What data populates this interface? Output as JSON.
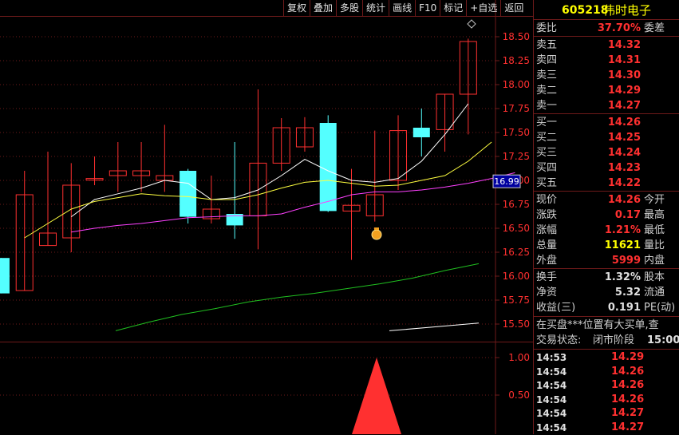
{
  "toolbar": {
    "buttons": [
      "复权",
      "叠加",
      "多股",
      "统计",
      "画线",
      "F10",
      "标记",
      "+自选",
      "返回"
    ]
  },
  "stock": {
    "code": "605218",
    "name": "伟时电子"
  },
  "quote": {
    "ratio_label": "委比",
    "ratio_value": "37.70%",
    "ratio_suffix": "委差",
    "sells": [
      {
        "label": "卖五",
        "price": "14.32"
      },
      {
        "label": "卖四",
        "price": "14.31"
      },
      {
        "label": "卖三",
        "price": "14.30"
      },
      {
        "label": "卖二",
        "price": "14.29"
      },
      {
        "label": "卖一",
        "price": "14.27"
      }
    ],
    "buys": [
      {
        "label": "买一",
        "price": "14.26"
      },
      {
        "label": "买二",
        "price": "14.25"
      },
      {
        "label": "买三",
        "price": "14.24"
      },
      {
        "label": "买四",
        "price": "14.23"
      },
      {
        "label": "买五",
        "price": "14.22"
      }
    ],
    "stats": [
      {
        "label": "现价",
        "value": "14.26",
        "suffix": "今开",
        "color": "red"
      },
      {
        "label": "涨跌",
        "value": "0.17",
        "suffix": "最高",
        "color": "red"
      },
      {
        "label": "涨幅",
        "value": "1.21%",
        "suffix": "最低",
        "color": "red"
      },
      {
        "label": "总量",
        "value": "11621",
        "suffix": "量比",
        "color": "yel"
      },
      {
        "label": "外盘",
        "value": "5999",
        "suffix": "内盘",
        "color": "red"
      }
    ],
    "stats2": [
      {
        "label": "换手",
        "value": "1.32%",
        "suffix": "股本",
        "color": "wht"
      },
      {
        "label": "净资",
        "value": "5.32",
        "suffix": "流通",
        "color": "wht"
      },
      {
        "label": "收益(三)",
        "value": "0.191",
        "suffix": "PE(动)",
        "color": "wht"
      }
    ],
    "message": "在买盘***位置有大买单,查",
    "status_label": "交易状态:",
    "status_value": "闭市阶段",
    "status_time": "15:00:"
  },
  "ticks": [
    {
      "time": "14:53",
      "price": "14.29"
    },
    {
      "time": "14:54",
      "price": "14.26"
    },
    {
      "time": "14:54",
      "price": "14.26"
    },
    {
      "time": "14:54",
      "price": "14.26"
    },
    {
      "time": "14:54",
      "price": "14.27"
    },
    {
      "time": "14:54",
      "price": "14.27"
    }
  ],
  "price_marker": "16.99",
  "colors": {
    "up": "#ff3030",
    "down": "#54ffff",
    "ma_white": "#ffffff",
    "ma_yellow": "#ffff40",
    "ma_magenta": "#ff40ff",
    "ma_green": "#20c020",
    "grid": "#6e1a1a"
  },
  "icons": {
    "toggle": "diamond-icon",
    "event": "money-bag-icon"
  },
  "chart_data": [
    {
      "type": "candlestick",
      "title": "",
      "ylim": [
        15.3,
        18.7
      ],
      "yticks": [
        "18.50",
        "18.25",
        "18.00",
        "17.75",
        "17.50",
        "17.25",
        "17.00",
        "16.75",
        "16.50",
        "16.25",
        "16.00",
        "15.75",
        "15.50"
      ],
      "grid": true,
      "candles": [
        {
          "o": 16.19,
          "h": 16.19,
          "l": 15.82,
          "c": 15.82
        },
        {
          "o": 15.85,
          "h": 17.1,
          "l": 15.85,
          "c": 16.85
        },
        {
          "o": 16.32,
          "h": 17.3,
          "l": 16.32,
          "c": 16.45
        },
        {
          "o": 16.4,
          "h": 17.18,
          "l": 16.25,
          "c": 16.95
        },
        {
          "o": 17.02,
          "h": 17.25,
          "l": 16.95,
          "c": 17.02
        },
        {
          "o": 17.05,
          "h": 17.4,
          "l": 16.88,
          "c": 17.1
        },
        {
          "o": 17.05,
          "h": 17.4,
          "l": 16.88,
          "c": 17.1
        },
        {
          "o": 17.0,
          "h": 17.58,
          "l": 16.88,
          "c": 17.05
        },
        {
          "o": 17.1,
          "h": 17.12,
          "l": 16.55,
          "c": 16.62
        },
        {
          "o": 16.6,
          "h": 17.05,
          "l": 16.55,
          "c": 16.7
        },
        {
          "o": 16.65,
          "h": 17.4,
          "l": 16.39,
          "c": 16.53
        },
        {
          "o": 16.63,
          "h": 17.95,
          "l": 16.28,
          "c": 17.18
        },
        {
          "o": 17.18,
          "h": 17.65,
          "l": 17.1,
          "c": 17.55
        },
        {
          "o": 17.35,
          "h": 17.66,
          "l": 17.3,
          "c": 17.55
        },
        {
          "o": 17.6,
          "h": 17.68,
          "l": 16.67,
          "c": 16.68
        },
        {
          "o": 16.68,
          "h": 17.12,
          "l": 16.17,
          "c": 16.74
        },
        {
          "o": 16.63,
          "h": 17.52,
          "l": 16.57,
          "c": 16.85
        },
        {
          "o": 17.0,
          "h": 17.68,
          "l": 16.9,
          "c": 17.52
        },
        {
          "o": 17.55,
          "h": 17.75,
          "l": 17.25,
          "c": 17.45
        },
        {
          "o": 17.53,
          "h": 17.9,
          "l": 17.3,
          "c": 17.9
        },
        {
          "o": 17.9,
          "h": 18.48,
          "l": 17.48,
          "c": 18.45
        }
      ],
      "series": [
        {
          "values": [
            null,
            null,
            null,
            null,
            16.62,
            16.8,
            16.86,
            16.92,
            17.0,
            16.97,
            16.8,
            16.82,
            16.9,
            17.05,
            17.22,
            17.1,
            17.0,
            16.98,
            17.02,
            17.2,
            17.48,
            17.8
          ]
        },
        {
          "values": [
            16.4,
            16.55,
            16.7,
            16.78,
            16.82,
            16.86,
            16.84,
            16.83,
            16.8,
            16.8,
            16.85,
            16.92,
            16.98,
            17.0,
            16.97,
            16.94,
            16.95,
            17.0,
            17.05,
            17.2,
            17.4
          ]
        },
        {
          "values": [
            16.46,
            16.5,
            16.53,
            16.55,
            16.58,
            16.61,
            16.62,
            16.63,
            16.63,
            16.65,
            16.72,
            16.78,
            16.85,
            16.88,
            16.88,
            16.9,
            16.93,
            16.97,
            17.02,
            17.08
          ]
        },
        {
          "values": [
            15.43,
            15.52,
            15.6,
            15.66,
            15.73,
            15.78,
            15.82,
            15.87,
            15.92,
            15.98,
            16.06,
            16.13
          ]
        },
        {
          "values": [
            15.43,
            15.47,
            15.51
          ]
        }
      ]
    },
    {
      "type": "area",
      "title": "",
      "ylim": [
        0,
        1.1
      ],
      "yticks": [
        "1.00",
        "0.50"
      ],
      "values": [
        0,
        1.0,
        0
      ]
    }
  ]
}
